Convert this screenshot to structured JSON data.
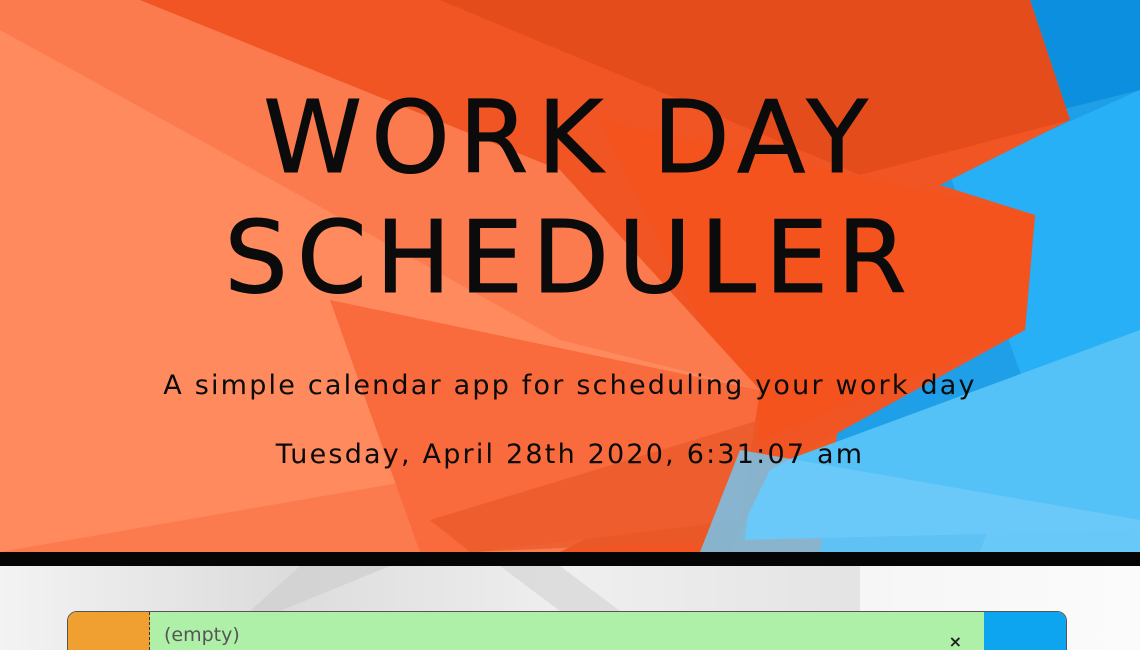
{
  "header": {
    "title_line1": "WORK DAY",
    "title_line2": "SCHEDULER",
    "subtitle": "A simple calendar app for scheduling your work day",
    "current_datetime": "Tuesday, April 28th 2020, 6:31:07 am"
  },
  "schedule": {
    "rows": [
      {
        "hour": "",
        "description": "(empty)",
        "clear_icon": "×"
      }
    ]
  },
  "colors": {
    "hero_orange": "#ef5a22",
    "hero_blue": "#2ba9ee",
    "hour_cell": "#f0a030",
    "present_row": "#aff0a8",
    "save_button": "#0ea5f0"
  },
  "icons": {
    "clear": "close-icon",
    "save": "save-icon"
  }
}
